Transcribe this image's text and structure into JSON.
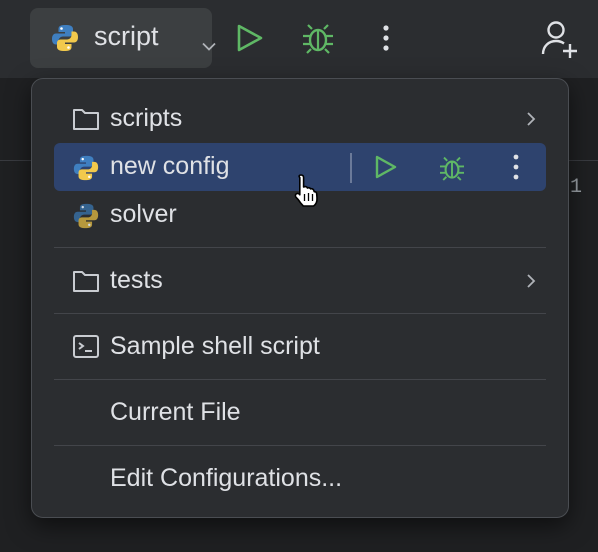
{
  "toolbar": {
    "config_name": "script",
    "config_icon": "python-icon",
    "actions": [
      "run-icon",
      "debug-icon",
      "more-icon",
      "add-user-icon"
    ]
  },
  "editor": {
    "line_number": "1"
  },
  "popup": {
    "groups": {
      "scripts": "scripts",
      "tests": "tests"
    },
    "items": {
      "new_config": "new config",
      "solver": "solver",
      "shell": "Sample shell script",
      "current_file": "Current File",
      "edit_configs": "Edit Configurations..."
    }
  },
  "colors": {
    "accent_selection": "#2e436e",
    "run_green": "#5fb865",
    "popup_bg": "#2b2d30",
    "toolbar_bg": "#2b2d30"
  }
}
